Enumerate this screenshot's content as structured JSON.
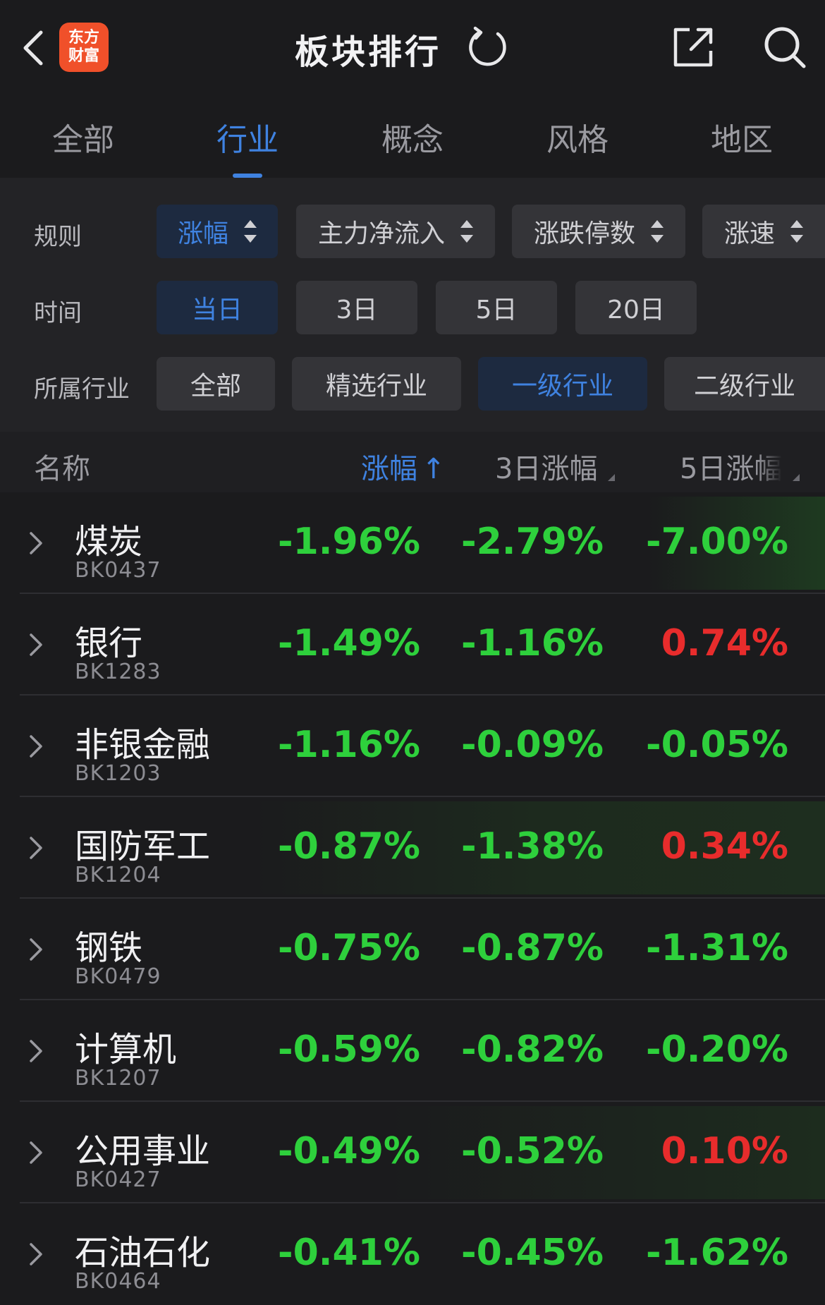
{
  "header": {
    "logo_line1": "东方",
    "logo_line2": "财富",
    "title": "板块排行"
  },
  "tabs": [
    {
      "label": "全部",
      "active": false
    },
    {
      "label": "行业",
      "active": true
    },
    {
      "label": "概念",
      "active": false
    },
    {
      "label": "风格",
      "active": false
    },
    {
      "label": "地区",
      "active": false
    }
  ],
  "filters": {
    "rule": {
      "label": "规则",
      "options": [
        "涨幅",
        "主力净流入",
        "涨跌停数",
        "涨速"
      ],
      "selected": "涨幅"
    },
    "time": {
      "label": "时间",
      "options": [
        "当日",
        "3日",
        "5日",
        "20日"
      ],
      "selected": "当日"
    },
    "industry": {
      "label": "所属行业",
      "options": [
        "全部",
        "精选行业",
        "一级行业",
        "二级行业"
      ],
      "selected": "一级行业"
    }
  },
  "table": {
    "columns": [
      "名称",
      "涨幅",
      "3日涨幅",
      "5日涨幅"
    ],
    "sort_arrow": "↑",
    "rows": [
      {
        "name": "煤炭",
        "code": "BK0437",
        "change": "-1.96%",
        "change_3d": "-2.79%",
        "change_5d": "-7.00%"
      },
      {
        "name": "银行",
        "code": "BK1283",
        "change": "-1.49%",
        "change_3d": "-1.16%",
        "change_5d": "0.74%"
      },
      {
        "name": "非银金融",
        "code": "BK1203",
        "change": "-1.16%",
        "change_3d": "-0.09%",
        "change_5d": "-0.05%"
      },
      {
        "name": "国防军工",
        "code": "BK1204",
        "change": "-0.87%",
        "change_3d": "-1.38%",
        "change_5d": "0.34%"
      },
      {
        "name": "钢铁",
        "code": "BK0479",
        "change": "-0.75%",
        "change_3d": "-0.87%",
        "change_5d": "-1.31%"
      },
      {
        "name": "计算机",
        "code": "BK1207",
        "change": "-0.59%",
        "change_3d": "-0.82%",
        "change_5d": "-0.20%"
      },
      {
        "name": "公用事业",
        "code": "BK0427",
        "change": "-0.49%",
        "change_3d": "-0.52%",
        "change_5d": "0.10%"
      },
      {
        "name": "石油石化",
        "code": "BK0464",
        "change": "-0.41%",
        "change_3d": "-0.45%",
        "change_5d": "-1.62%"
      }
    ]
  },
  "colors": {
    "background": "#1b1b1d",
    "accent": "#3f82e0",
    "down": "#2ed03c",
    "up": "#e82c2c",
    "brand": "#f0502a"
  }
}
